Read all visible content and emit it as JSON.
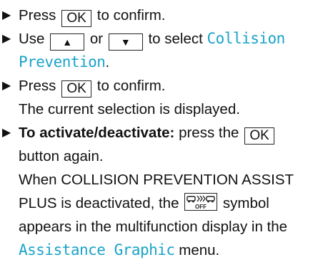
{
  "arrow_glyph": "▶",
  "keys": {
    "ok": "OK",
    "up": "▲",
    "down": "▼"
  },
  "steps": [
    {
      "before": "Press ",
      "after": " to confirm."
    },
    {
      "use": "Use ",
      "or": " or ",
      "to_select": " to select ",
      "display_line1": "Collision",
      "display_line2": "Prevention",
      "end": "."
    },
    {
      "before": "Press ",
      "after": " to confirm.",
      "line2": "The current selection is displayed."
    },
    {
      "bold": "To activate/deactivate:",
      "rest": " press the ",
      "line2": "button again.",
      "line3": "When COLLISION PREVENTION ASSIST",
      "line4_before": "PLUS is deactivated, the ",
      "line4_after": " symbol",
      "line5": "appears in the multifunction display in the",
      "display_menu": "Assistance Graphic",
      "menu_end": " menu."
    }
  ],
  "colors": {
    "display_text": "#1aa3c8",
    "text": "#111111"
  },
  "icons": {
    "symbol": "collision-prevention-off-icon",
    "symbol_text": "OFF"
  }
}
